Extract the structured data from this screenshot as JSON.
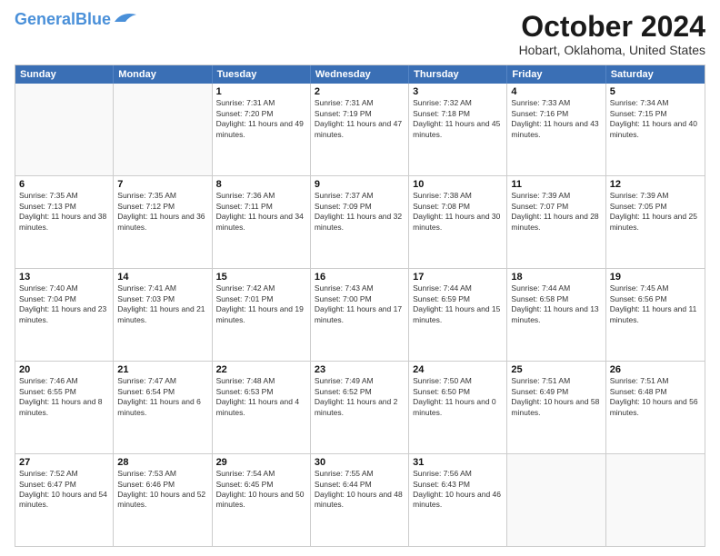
{
  "logo": {
    "line1": "General",
    "line2": "Blue"
  },
  "title": "October 2024",
  "subtitle": "Hobart, Oklahoma, United States",
  "days": [
    "Sunday",
    "Monday",
    "Tuesday",
    "Wednesday",
    "Thursday",
    "Friday",
    "Saturday"
  ],
  "weeks": [
    [
      {
        "day": "",
        "info": ""
      },
      {
        "day": "",
        "info": ""
      },
      {
        "day": "1",
        "info": "Sunrise: 7:31 AM\nSunset: 7:20 PM\nDaylight: 11 hours and 49 minutes."
      },
      {
        "day": "2",
        "info": "Sunrise: 7:31 AM\nSunset: 7:19 PM\nDaylight: 11 hours and 47 minutes."
      },
      {
        "day": "3",
        "info": "Sunrise: 7:32 AM\nSunset: 7:18 PM\nDaylight: 11 hours and 45 minutes."
      },
      {
        "day": "4",
        "info": "Sunrise: 7:33 AM\nSunset: 7:16 PM\nDaylight: 11 hours and 43 minutes."
      },
      {
        "day": "5",
        "info": "Sunrise: 7:34 AM\nSunset: 7:15 PM\nDaylight: 11 hours and 40 minutes."
      }
    ],
    [
      {
        "day": "6",
        "info": "Sunrise: 7:35 AM\nSunset: 7:13 PM\nDaylight: 11 hours and 38 minutes."
      },
      {
        "day": "7",
        "info": "Sunrise: 7:35 AM\nSunset: 7:12 PM\nDaylight: 11 hours and 36 minutes."
      },
      {
        "day": "8",
        "info": "Sunrise: 7:36 AM\nSunset: 7:11 PM\nDaylight: 11 hours and 34 minutes."
      },
      {
        "day": "9",
        "info": "Sunrise: 7:37 AM\nSunset: 7:09 PM\nDaylight: 11 hours and 32 minutes."
      },
      {
        "day": "10",
        "info": "Sunrise: 7:38 AM\nSunset: 7:08 PM\nDaylight: 11 hours and 30 minutes."
      },
      {
        "day": "11",
        "info": "Sunrise: 7:39 AM\nSunset: 7:07 PM\nDaylight: 11 hours and 28 minutes."
      },
      {
        "day": "12",
        "info": "Sunrise: 7:39 AM\nSunset: 7:05 PM\nDaylight: 11 hours and 25 minutes."
      }
    ],
    [
      {
        "day": "13",
        "info": "Sunrise: 7:40 AM\nSunset: 7:04 PM\nDaylight: 11 hours and 23 minutes."
      },
      {
        "day": "14",
        "info": "Sunrise: 7:41 AM\nSunset: 7:03 PM\nDaylight: 11 hours and 21 minutes."
      },
      {
        "day": "15",
        "info": "Sunrise: 7:42 AM\nSunset: 7:01 PM\nDaylight: 11 hours and 19 minutes."
      },
      {
        "day": "16",
        "info": "Sunrise: 7:43 AM\nSunset: 7:00 PM\nDaylight: 11 hours and 17 minutes."
      },
      {
        "day": "17",
        "info": "Sunrise: 7:44 AM\nSunset: 6:59 PM\nDaylight: 11 hours and 15 minutes."
      },
      {
        "day": "18",
        "info": "Sunrise: 7:44 AM\nSunset: 6:58 PM\nDaylight: 11 hours and 13 minutes."
      },
      {
        "day": "19",
        "info": "Sunrise: 7:45 AM\nSunset: 6:56 PM\nDaylight: 11 hours and 11 minutes."
      }
    ],
    [
      {
        "day": "20",
        "info": "Sunrise: 7:46 AM\nSunset: 6:55 PM\nDaylight: 11 hours and 8 minutes."
      },
      {
        "day": "21",
        "info": "Sunrise: 7:47 AM\nSunset: 6:54 PM\nDaylight: 11 hours and 6 minutes."
      },
      {
        "day": "22",
        "info": "Sunrise: 7:48 AM\nSunset: 6:53 PM\nDaylight: 11 hours and 4 minutes."
      },
      {
        "day": "23",
        "info": "Sunrise: 7:49 AM\nSunset: 6:52 PM\nDaylight: 11 hours and 2 minutes."
      },
      {
        "day": "24",
        "info": "Sunrise: 7:50 AM\nSunset: 6:50 PM\nDaylight: 11 hours and 0 minutes."
      },
      {
        "day": "25",
        "info": "Sunrise: 7:51 AM\nSunset: 6:49 PM\nDaylight: 10 hours and 58 minutes."
      },
      {
        "day": "26",
        "info": "Sunrise: 7:51 AM\nSunset: 6:48 PM\nDaylight: 10 hours and 56 minutes."
      }
    ],
    [
      {
        "day": "27",
        "info": "Sunrise: 7:52 AM\nSunset: 6:47 PM\nDaylight: 10 hours and 54 minutes."
      },
      {
        "day": "28",
        "info": "Sunrise: 7:53 AM\nSunset: 6:46 PM\nDaylight: 10 hours and 52 minutes."
      },
      {
        "day": "29",
        "info": "Sunrise: 7:54 AM\nSunset: 6:45 PM\nDaylight: 10 hours and 50 minutes."
      },
      {
        "day": "30",
        "info": "Sunrise: 7:55 AM\nSunset: 6:44 PM\nDaylight: 10 hours and 48 minutes."
      },
      {
        "day": "31",
        "info": "Sunrise: 7:56 AM\nSunset: 6:43 PM\nDaylight: 10 hours and 46 minutes."
      },
      {
        "day": "",
        "info": ""
      },
      {
        "day": "",
        "info": ""
      }
    ]
  ]
}
